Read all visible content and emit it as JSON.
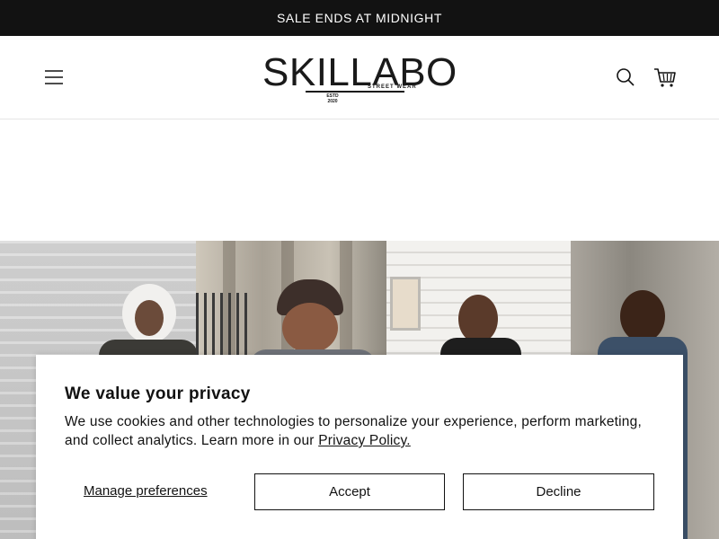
{
  "announcement": {
    "text": "SALE ENDS AT MIDNIGHT"
  },
  "header": {
    "logo": {
      "name": "SKILLABO",
      "tagline": "STREET WEAR",
      "est_line1": "ESTD",
      "est_line2": "2020"
    },
    "icons": {
      "menu": "hamburger-menu-icon",
      "search": "search-icon",
      "cart": "cart-icon"
    }
  },
  "hero": {
    "description_icon": "photo-collage"
  },
  "cookie_banner": {
    "title": "We value your privacy",
    "body": "We use cookies and other technologies to personalize your experience, perform marketing, and collect analytics. Learn more in our ",
    "link_text": "Privacy Policy.",
    "manage_label": "Manage preferences",
    "accept_label": "Accept",
    "decline_label": "Decline"
  },
  "colors": {
    "announcement_bg": "#121212",
    "text": "#121212",
    "background": "#ffffff"
  }
}
